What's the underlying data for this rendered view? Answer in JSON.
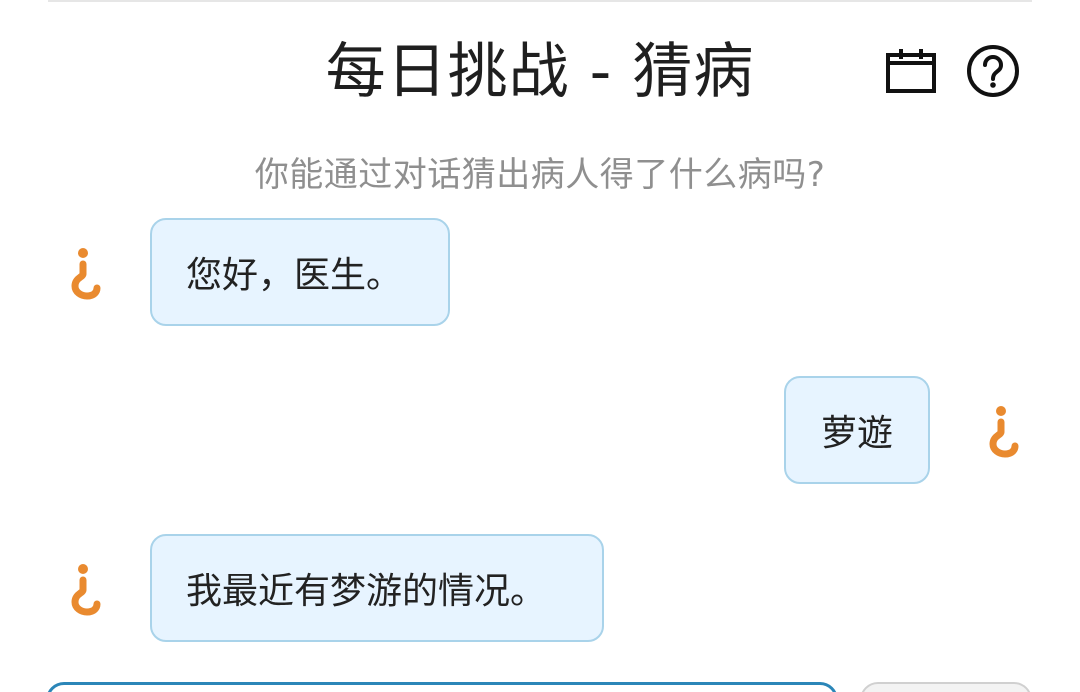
{
  "header": {
    "title": "每日挑战 - 猜病",
    "subtitle": "你能通过对话猜出病人得了什么病吗?",
    "icons": [
      "calendar-icon",
      "help-icon"
    ]
  },
  "messages": [
    {
      "sender": "patient",
      "text": "您好，医生。",
      "avatar_icon": "inverted-question-mark-icon"
    },
    {
      "sender": "doctor",
      "text": "萝遊",
      "avatar_icon": "inverted-question-mark-icon"
    },
    {
      "sender": "patient",
      "text": "我最近有梦游的情况。",
      "avatar_icon": "inverted-question-mark-icon"
    }
  ],
  "colors": {
    "bubble_bg": "#e7f4ff",
    "bubble_border": "#a9d3ea",
    "avatar_accent": "#e98a2f",
    "input_border": "#2b86b8"
  }
}
